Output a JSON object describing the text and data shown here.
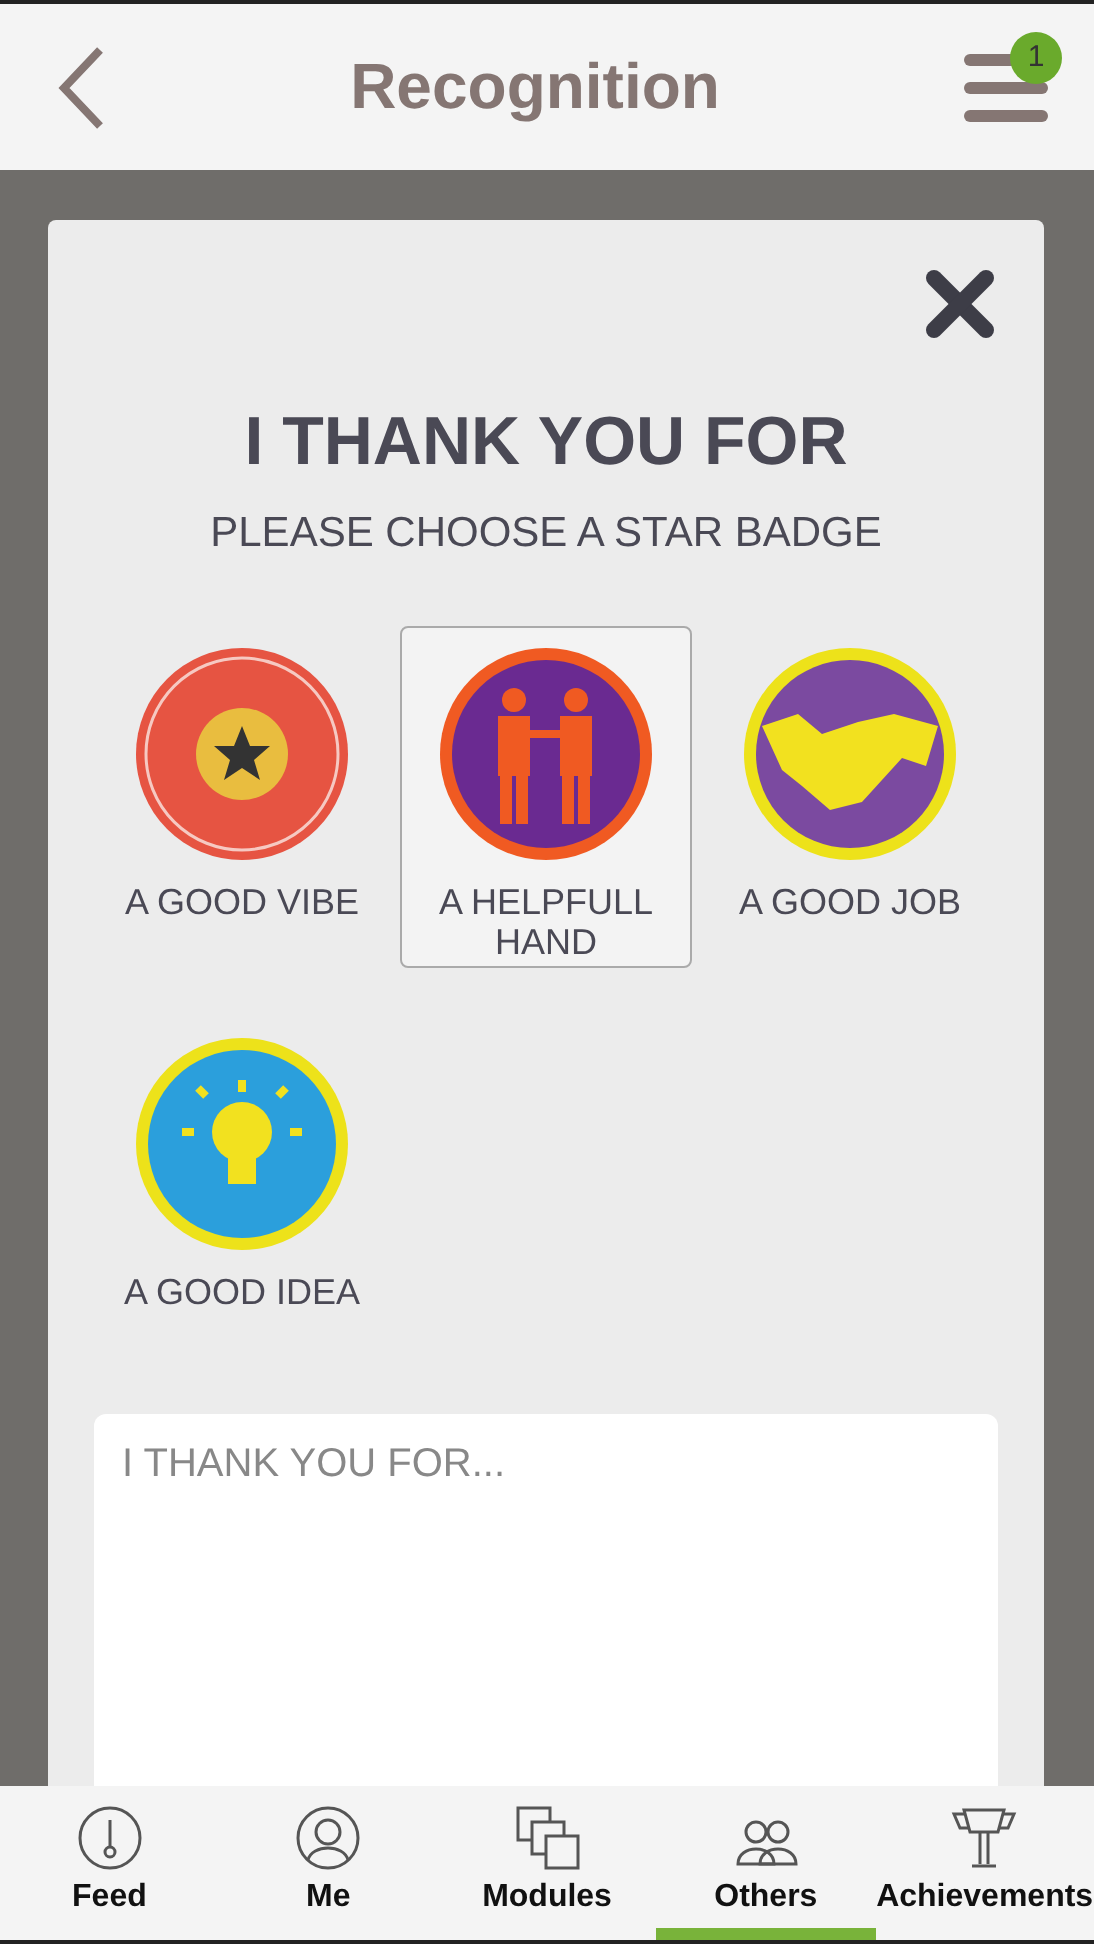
{
  "header": {
    "title": "Recognition",
    "menu_badge": "1"
  },
  "dialog": {
    "title": "I THANK YOU FOR",
    "subtitle": "PLEASE CHOOSE A STAR BADGE",
    "badges": [
      {
        "label": "A GOOD VIBE",
        "kind": "star",
        "selected": false
      },
      {
        "label": "A HELPFULL HAND",
        "kind": "people",
        "selected": true
      },
      {
        "label": "A GOOD JOB",
        "kind": "handshake",
        "selected": false
      },
      {
        "label": "A GOOD IDEA",
        "kind": "bulb",
        "selected": false
      }
    ],
    "message": {
      "placeholder": "I THANK YOU FOR..."
    }
  },
  "tab_bar": [
    {
      "label": "Feed",
      "kind": "gauge",
      "selected": false
    },
    {
      "label": "Me",
      "kind": "person",
      "selected": false
    },
    {
      "label": "Modules",
      "kind": "stack",
      "selected": false
    },
    {
      "label": "Others",
      "kind": "group",
      "selected": true
    },
    {
      "label": "Achievements",
      "kind": "trophy",
      "selected": false
    }
  ]
}
